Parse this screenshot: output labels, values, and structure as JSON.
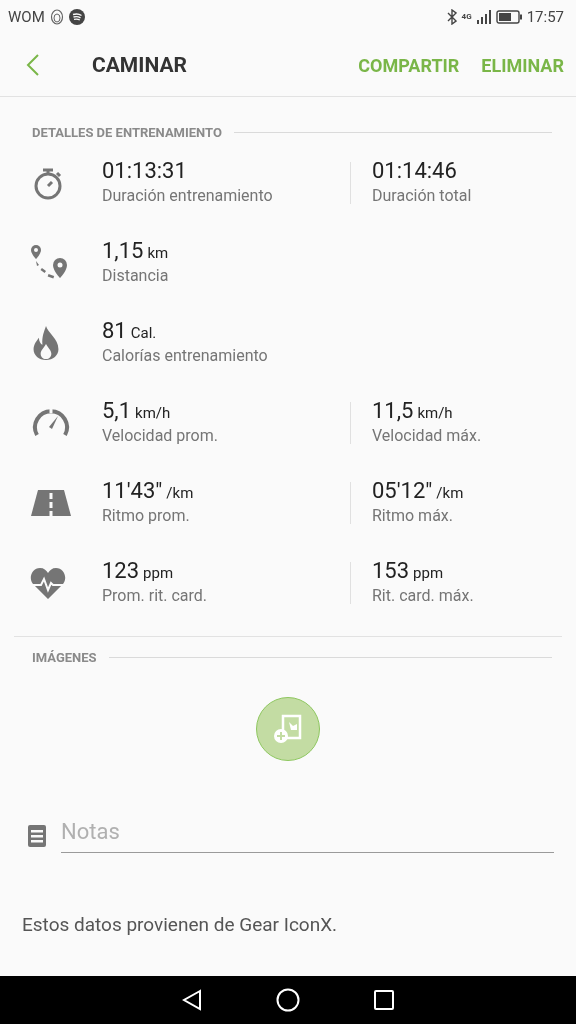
{
  "status_bar": {
    "carrier": "WOM",
    "network": "4G",
    "time": "17:57"
  },
  "app_bar": {
    "title": "CAMINAR",
    "actions": [
      "COMPARTIR",
      "ELIMINAR"
    ]
  },
  "details": {
    "heading": "DETALLES DE ENTRENAMIENTO",
    "rows": [
      {
        "kind": "stopwatch",
        "stats": [
          {
            "value": "01:13:31",
            "label": "Duración entrenamiento"
          },
          {
            "value": "01:14:46",
            "label": "Duración total"
          }
        ]
      },
      {
        "kind": "route",
        "stats": [
          {
            "value": "1,15",
            "unit": "km",
            "label": "Distancia"
          }
        ]
      },
      {
        "kind": "flame",
        "stats": [
          {
            "value": "81",
            "unit": "Cal.",
            "label": "Calorías entrenamiento"
          }
        ]
      },
      {
        "kind": "gauge",
        "stats": [
          {
            "value": "5,1",
            "unit": "km/h",
            "label": "Velocidad prom."
          },
          {
            "value": "11,5",
            "unit": "km/h",
            "label": "Velocidad máx."
          }
        ]
      },
      {
        "kind": "road",
        "stats": [
          {
            "value": "11'43\"",
            "unit": "/km",
            "label": "Ritmo prom."
          },
          {
            "value": "05'12\"",
            "unit": "/km",
            "label": "Ritmo máx."
          }
        ]
      },
      {
        "kind": "heart",
        "stats": [
          {
            "value": "123",
            "unit": "ppm",
            "label": "Prom. rit. card."
          },
          {
            "value": "153",
            "unit": "ppm",
            "label": "Rit. card. máx."
          }
        ]
      }
    ]
  },
  "images": {
    "heading": "IMÁGENES"
  },
  "notes": {
    "placeholder": "Notas"
  },
  "footer": "Estos datos provienen de Gear IconX."
}
